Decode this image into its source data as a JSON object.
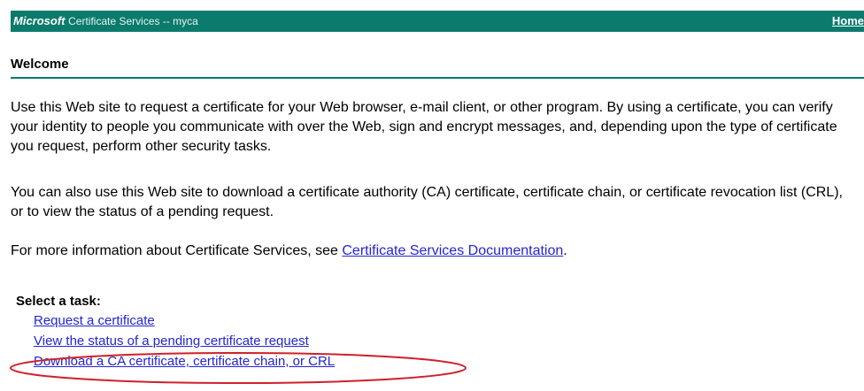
{
  "header": {
    "brand": "Microsoft",
    "title": "Certificate Services  --  myca",
    "home_label": "Home"
  },
  "welcome": {
    "heading": "Welcome",
    "paragraph1": "Use this Web site to request a certificate for your Web browser, e-mail client, or other program. By using a certificate, you can verify your identity to people you communicate with over the Web, sign and encrypt messages, and, depending upon the type of certificate you request, perform other security tasks.",
    "paragraph2": "You can also use this Web site to download a certificate authority (CA) certificate, certificate chain, or certificate revocation list (CRL), or to view the status of a pending request.",
    "paragraph3_prefix": "For more information about Certificate Services, see ",
    "doc_link_label": "Certificate Services Documentation",
    "paragraph3_suffix": "."
  },
  "tasks": {
    "heading": "Select a task:",
    "items": [
      {
        "label": "Request a certificate"
      },
      {
        "label": "View the status of a pending certificate request"
      },
      {
        "label": "Download a CA certificate, certificate chain, or CRL"
      }
    ]
  },
  "annotation": {
    "highlight_color": "#d0202a"
  }
}
